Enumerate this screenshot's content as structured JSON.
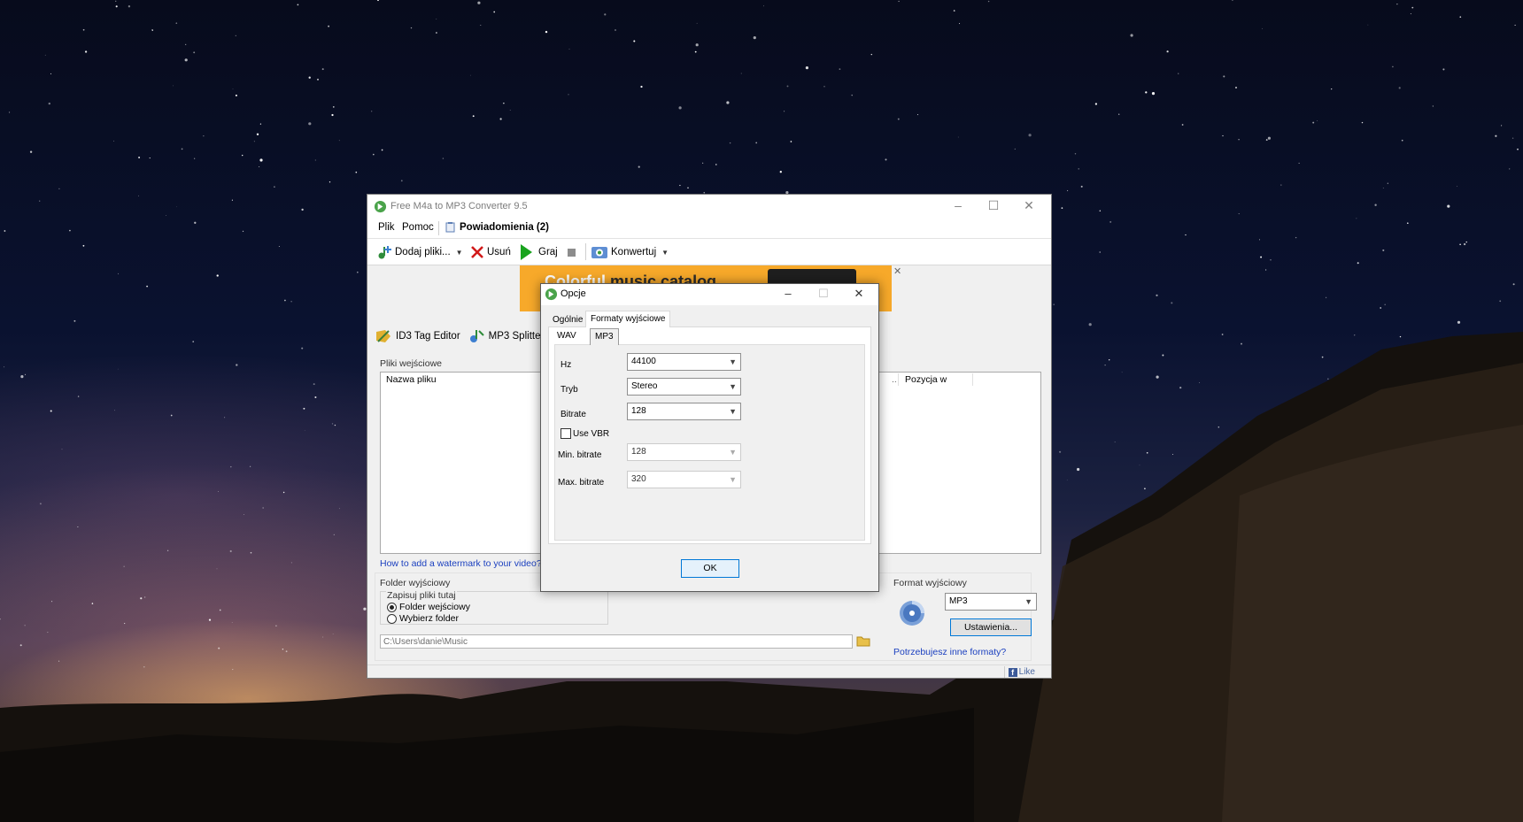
{
  "main_window": {
    "title": "Free M4a to MP3 Converter 9.5",
    "menu": {
      "file": "Plik",
      "help": "Pomoc",
      "notifications": "Powiadomienia (2)"
    },
    "toolbar": {
      "add_files": "Dodaj pliki...",
      "remove": "Usuń",
      "play": "Graj",
      "convert": "Konwertuj"
    },
    "banner": {
      "word1": "Colorful",
      "word2": "music catalog"
    },
    "tools": {
      "id3": "ID3 Tag Editor",
      "splitter": "MP3 Splitter"
    },
    "input_files": {
      "label": "Pliki wejściowe",
      "col_name": "Nazwa pliku",
      "col_position": "Pozycja w"
    },
    "watermark_link": "How to add a watermark to your video?",
    "output_folder": {
      "label": "Folder wyjściowy",
      "save_here": "Zapisuj pliki tutaj",
      "option_input": "Folder wejściowy",
      "option_choose": "Wybierz folder",
      "path": "C:\\Users\\danie\\Music"
    },
    "output_format": {
      "label": "Format wyjściowy",
      "value": "MP3",
      "settings_button": "Ustawienia...",
      "more_formats_link": "Potrzebujesz inne formaty?"
    },
    "fb_like": "Like"
  },
  "dialog": {
    "title": "Opcje",
    "tabs": [
      "Ogólnie",
      "Formaty wyjściowe"
    ],
    "subtabs": [
      "WAV",
      "MP3"
    ],
    "fields": {
      "hz_label": "Hz",
      "hz_value": "44100",
      "mode_label": "Tryb",
      "mode_value": "Stereo",
      "bitrate_label": "Bitrate",
      "bitrate_value": "128",
      "vbr_label": "Use VBR",
      "min_label": "Min. bitrate",
      "min_value": "128",
      "max_label": "Max. bitrate",
      "max_value": "320"
    },
    "ok": "OK"
  },
  "colors": {
    "accent": "#0078d7",
    "banner": "#f7a92a",
    "link": "#1a3fbf"
  }
}
